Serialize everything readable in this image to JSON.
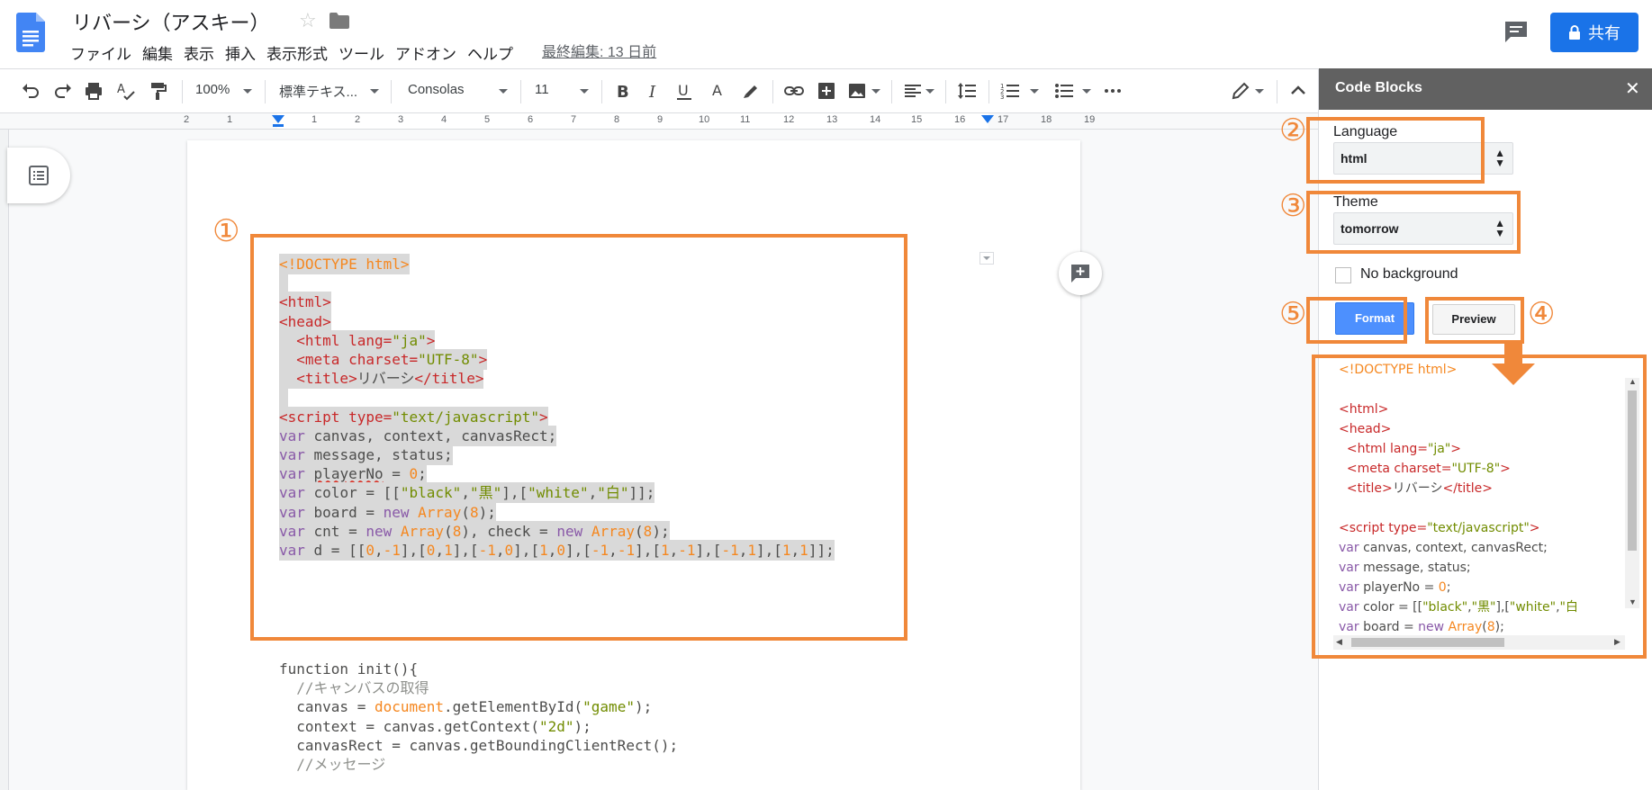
{
  "header": {
    "title": "リバーシ（アスキー）",
    "menu": [
      "ファイル",
      "編集",
      "表示",
      "挿入",
      "表示形式",
      "ツール",
      "アドオン",
      "ヘルプ"
    ],
    "last_edit": "最終編集: 13 日前",
    "share_label": "共有"
  },
  "toolbar": {
    "zoom": "100%",
    "style": "標準テキス...",
    "font": "Consolas",
    "size": "11"
  },
  "ruler": [
    "2",
    "1",
    "1",
    "2",
    "3",
    "4",
    "5",
    "6",
    "7",
    "8",
    "9",
    "10",
    "11",
    "12",
    "13",
    "14",
    "15",
    "16",
    "17",
    "18",
    "19"
  ],
  "badges": {
    "b1": "①",
    "b2": "②",
    "b3": "③",
    "b4": "④",
    "b5": "⑤"
  },
  "document": {
    "code_lines": [
      [
        {
          "t": "<!DOCTYPE html>",
          "c": "c-doctype"
        }
      ],
      [
        {
          "t": " ",
          "c": "c-plain"
        }
      ],
      [
        {
          "t": "<html>",
          "c": "c-tag"
        }
      ],
      [
        {
          "t": "<head>",
          "c": "c-tag"
        }
      ],
      [
        {
          "t": "  ",
          "c": "c-plain"
        },
        {
          "t": "<html lang=",
          "c": "c-tag"
        },
        {
          "t": "\"ja\"",
          "c": "c-str"
        },
        {
          "t": ">",
          "c": "c-tag"
        }
      ],
      [
        {
          "t": "  ",
          "c": "c-plain"
        },
        {
          "t": "<meta charset=",
          "c": "c-tag"
        },
        {
          "t": "\"UTF-8\"",
          "c": "c-str"
        },
        {
          "t": ">",
          "c": "c-tag"
        }
      ],
      [
        {
          "t": "  ",
          "c": "c-plain"
        },
        {
          "t": "<title>",
          "c": "c-tag"
        },
        {
          "t": "リバーシ",
          "c": "c-plain"
        },
        {
          "t": "</title>",
          "c": "c-tag"
        }
      ],
      [
        {
          "t": " ",
          "c": "c-plain"
        }
      ],
      [
        {
          "t": "<script type=",
          "c": "c-tag"
        },
        {
          "t": "\"text/javascript\"",
          "c": "c-str"
        },
        {
          "t": ">",
          "c": "c-tag"
        }
      ],
      [
        {
          "t": "var",
          "c": "c-kw"
        },
        {
          "t": " canvas, context, canvasRect;",
          "c": "c-plain"
        }
      ],
      [
        {
          "t": "var",
          "c": "c-kw"
        },
        {
          "t": " message, status;",
          "c": "c-plain"
        }
      ],
      [
        {
          "t": "var",
          "c": "c-kw"
        },
        {
          "t": " ",
          "c": "c-plain"
        },
        {
          "t": "playerNo",
          "c": "c-plain squiggle"
        },
        {
          "t": " = ",
          "c": "c-plain"
        },
        {
          "t": "0",
          "c": "c-num"
        },
        {
          "t": ";",
          "c": "c-plain"
        }
      ],
      [
        {
          "t": "var",
          "c": "c-kw"
        },
        {
          "t": " color = [[",
          "c": "c-plain"
        },
        {
          "t": "\"black\"",
          "c": "c-str"
        },
        {
          "t": ",",
          "c": "c-plain"
        },
        {
          "t": "\"黒\"",
          "c": "c-str"
        },
        {
          "t": "],[",
          "c": "c-plain"
        },
        {
          "t": "\"white\"",
          "c": "c-str"
        },
        {
          "t": ",",
          "c": "c-plain"
        },
        {
          "t": "\"白\"",
          "c": "c-str"
        },
        {
          "t": "]];",
          "c": "c-plain"
        }
      ],
      [
        {
          "t": "var",
          "c": "c-kw"
        },
        {
          "t": " board = ",
          "c": "c-plain"
        },
        {
          "t": "new",
          "c": "c-kw"
        },
        {
          "t": " ",
          "c": "c-plain"
        },
        {
          "t": "Array",
          "c": "c-obj"
        },
        {
          "t": "(",
          "c": "c-plain"
        },
        {
          "t": "8",
          "c": "c-num"
        },
        {
          "t": ");",
          "c": "c-plain"
        }
      ],
      [
        {
          "t": "var",
          "c": "c-kw"
        },
        {
          "t": " cnt = ",
          "c": "c-plain"
        },
        {
          "t": "new",
          "c": "c-kw"
        },
        {
          "t": " ",
          "c": "c-plain"
        },
        {
          "t": "Array",
          "c": "c-obj"
        },
        {
          "t": "(",
          "c": "c-plain"
        },
        {
          "t": "8",
          "c": "c-num"
        },
        {
          "t": "), check = ",
          "c": "c-plain"
        },
        {
          "t": "new",
          "c": "c-kw"
        },
        {
          "t": " ",
          "c": "c-plain"
        },
        {
          "t": "Array",
          "c": "c-obj"
        },
        {
          "t": "(",
          "c": "c-plain"
        },
        {
          "t": "8",
          "c": "c-num"
        },
        {
          "t": ");",
          "c": "c-plain"
        }
      ],
      [
        {
          "t": "var",
          "c": "c-kw"
        },
        {
          "t": " d = [[",
          "c": "c-plain"
        },
        {
          "t": "0",
          "c": "c-num"
        },
        {
          "t": ",",
          "c": "c-plain"
        },
        {
          "t": "-1",
          "c": "c-num"
        },
        {
          "t": "],[",
          "c": "c-plain"
        },
        {
          "t": "0",
          "c": "c-num"
        },
        {
          "t": ",",
          "c": "c-plain"
        },
        {
          "t": "1",
          "c": "c-num"
        },
        {
          "t": "],[",
          "c": "c-plain"
        },
        {
          "t": "-1",
          "c": "c-num"
        },
        {
          "t": ",",
          "c": "c-plain"
        },
        {
          "t": "0",
          "c": "c-num"
        },
        {
          "t": "],[",
          "c": "c-plain"
        },
        {
          "t": "1",
          "c": "c-num"
        },
        {
          "t": ",",
          "c": "c-plain"
        },
        {
          "t": "0",
          "c": "c-num"
        },
        {
          "t": "],[",
          "c": "c-plain"
        },
        {
          "t": "-1",
          "c": "c-num"
        },
        {
          "t": ",",
          "c": "c-plain"
        },
        {
          "t": "-1",
          "c": "c-num"
        },
        {
          "t": "],[",
          "c": "c-plain"
        },
        {
          "t": "1",
          "c": "c-num"
        },
        {
          "t": ",",
          "c": "c-plain"
        },
        {
          "t": "-1",
          "c": "c-num"
        },
        {
          "t": "],[",
          "c": "c-plain"
        },
        {
          "t": "-1",
          "c": "c-num"
        },
        {
          "t": ",",
          "c": "c-plain"
        },
        {
          "t": "1",
          "c": "c-num"
        },
        {
          "t": "],[",
          "c": "c-plain"
        },
        {
          "t": "1",
          "c": "c-num"
        },
        {
          "t": ",",
          "c": "c-plain"
        },
        {
          "t": "1",
          "c": "c-num"
        },
        {
          "t": "]];",
          "c": "c-plain"
        }
      ]
    ],
    "body_lines": [
      [
        {
          "t": "function init(){",
          "c": "c-plain"
        }
      ],
      [
        {
          "t": "  //キャンバスの取得",
          "c": "c-cmt"
        }
      ],
      [
        {
          "t": "  canvas = ",
          "c": "c-plain"
        },
        {
          "t": "document",
          "c": "c-obj"
        },
        {
          "t": ".getElementById(",
          "c": "c-plain"
        },
        {
          "t": "\"game\"",
          "c": "c-str"
        },
        {
          "t": ");",
          "c": "c-plain"
        }
      ],
      [
        {
          "t": "  context = canvas.getContext(",
          "c": "c-plain"
        },
        {
          "t": "\"2d\"",
          "c": "c-str"
        },
        {
          "t": ");",
          "c": "c-plain"
        }
      ],
      [
        {
          "t": "  canvasRect = canvas.getBoundingClientRect();",
          "c": "c-plain"
        }
      ],
      [
        {
          "t": "  //メッセージ",
          "c": "c-cmt"
        }
      ]
    ]
  },
  "panel": {
    "title": "Code Blocks",
    "close": "✕",
    "language_label": "Language",
    "language_value": "html",
    "theme_label": "Theme",
    "theme_value": "tomorrow",
    "no_background_label": "No background",
    "format_label": "Format",
    "preview_label": "Preview",
    "preview_lines": [
      [
        {
          "t": "<!DOCTYPE html>",
          "c": "c-doctype"
        }
      ],
      [
        {
          "t": "",
          "c": "c-plain"
        }
      ],
      [
        {
          "t": "<html>",
          "c": "c-tag"
        }
      ],
      [
        {
          "t": "<head>",
          "c": "c-tag"
        }
      ],
      [
        {
          "t": "  <html lang=",
          "c": "c-tag"
        },
        {
          "t": "\"ja\"",
          "c": "c-str"
        },
        {
          "t": ">",
          "c": "c-tag"
        }
      ],
      [
        {
          "t": "  <meta charset=",
          "c": "c-tag"
        },
        {
          "t": "\"UTF-8\"",
          "c": "c-str"
        },
        {
          "t": ">",
          "c": "c-tag"
        }
      ],
      [
        {
          "t": "  <title>",
          "c": "c-tag"
        },
        {
          "t": "リバーシ",
          "c": "c-plain"
        },
        {
          "t": "</title>",
          "c": "c-tag"
        }
      ],
      [
        {
          "t": "",
          "c": "c-plain"
        }
      ],
      [
        {
          "t": "<script type=",
          "c": "c-tag"
        },
        {
          "t": "\"text/javascript\"",
          "c": "c-str"
        },
        {
          "t": ">",
          "c": "c-tag"
        }
      ],
      [
        {
          "t": "var",
          "c": "c-kw"
        },
        {
          "t": " canvas, context, canvasRect;",
          "c": "c-plain"
        }
      ],
      [
        {
          "t": "var",
          "c": "c-kw"
        },
        {
          "t": " message, status;",
          "c": "c-plain"
        }
      ],
      [
        {
          "t": "var",
          "c": "c-kw"
        },
        {
          "t": " playerNo = ",
          "c": "c-plain"
        },
        {
          "t": "0",
          "c": "c-num"
        },
        {
          "t": ";",
          "c": "c-plain"
        }
      ],
      [
        {
          "t": "var",
          "c": "c-kw"
        },
        {
          "t": " color = [[",
          "c": "c-plain"
        },
        {
          "t": "\"black\"",
          "c": "c-str"
        },
        {
          "t": ",",
          "c": "c-plain"
        },
        {
          "t": "\"黒\"",
          "c": "c-str"
        },
        {
          "t": "],[",
          "c": "c-plain"
        },
        {
          "t": "\"white\"",
          "c": "c-str"
        },
        {
          "t": ",",
          "c": "c-plain"
        },
        {
          "t": "\"白",
          "c": "c-str"
        }
      ],
      [
        {
          "t": "var",
          "c": "c-kw"
        },
        {
          "t": " board = ",
          "c": "c-plain"
        },
        {
          "t": "new",
          "c": "c-kw"
        },
        {
          "t": " ",
          "c": "c-plain"
        },
        {
          "t": "Array",
          "c": "c-obj"
        },
        {
          "t": "(",
          "c": "c-plain"
        },
        {
          "t": "8",
          "c": "c-num"
        },
        {
          "t": ");",
          "c": "c-plain"
        }
      ]
    ]
  },
  "colors": {
    "accent_orange": "#f0883a",
    "share_blue": "#1a73e8",
    "format_blue": "#4d90fe",
    "panel_header": "#616161"
  }
}
